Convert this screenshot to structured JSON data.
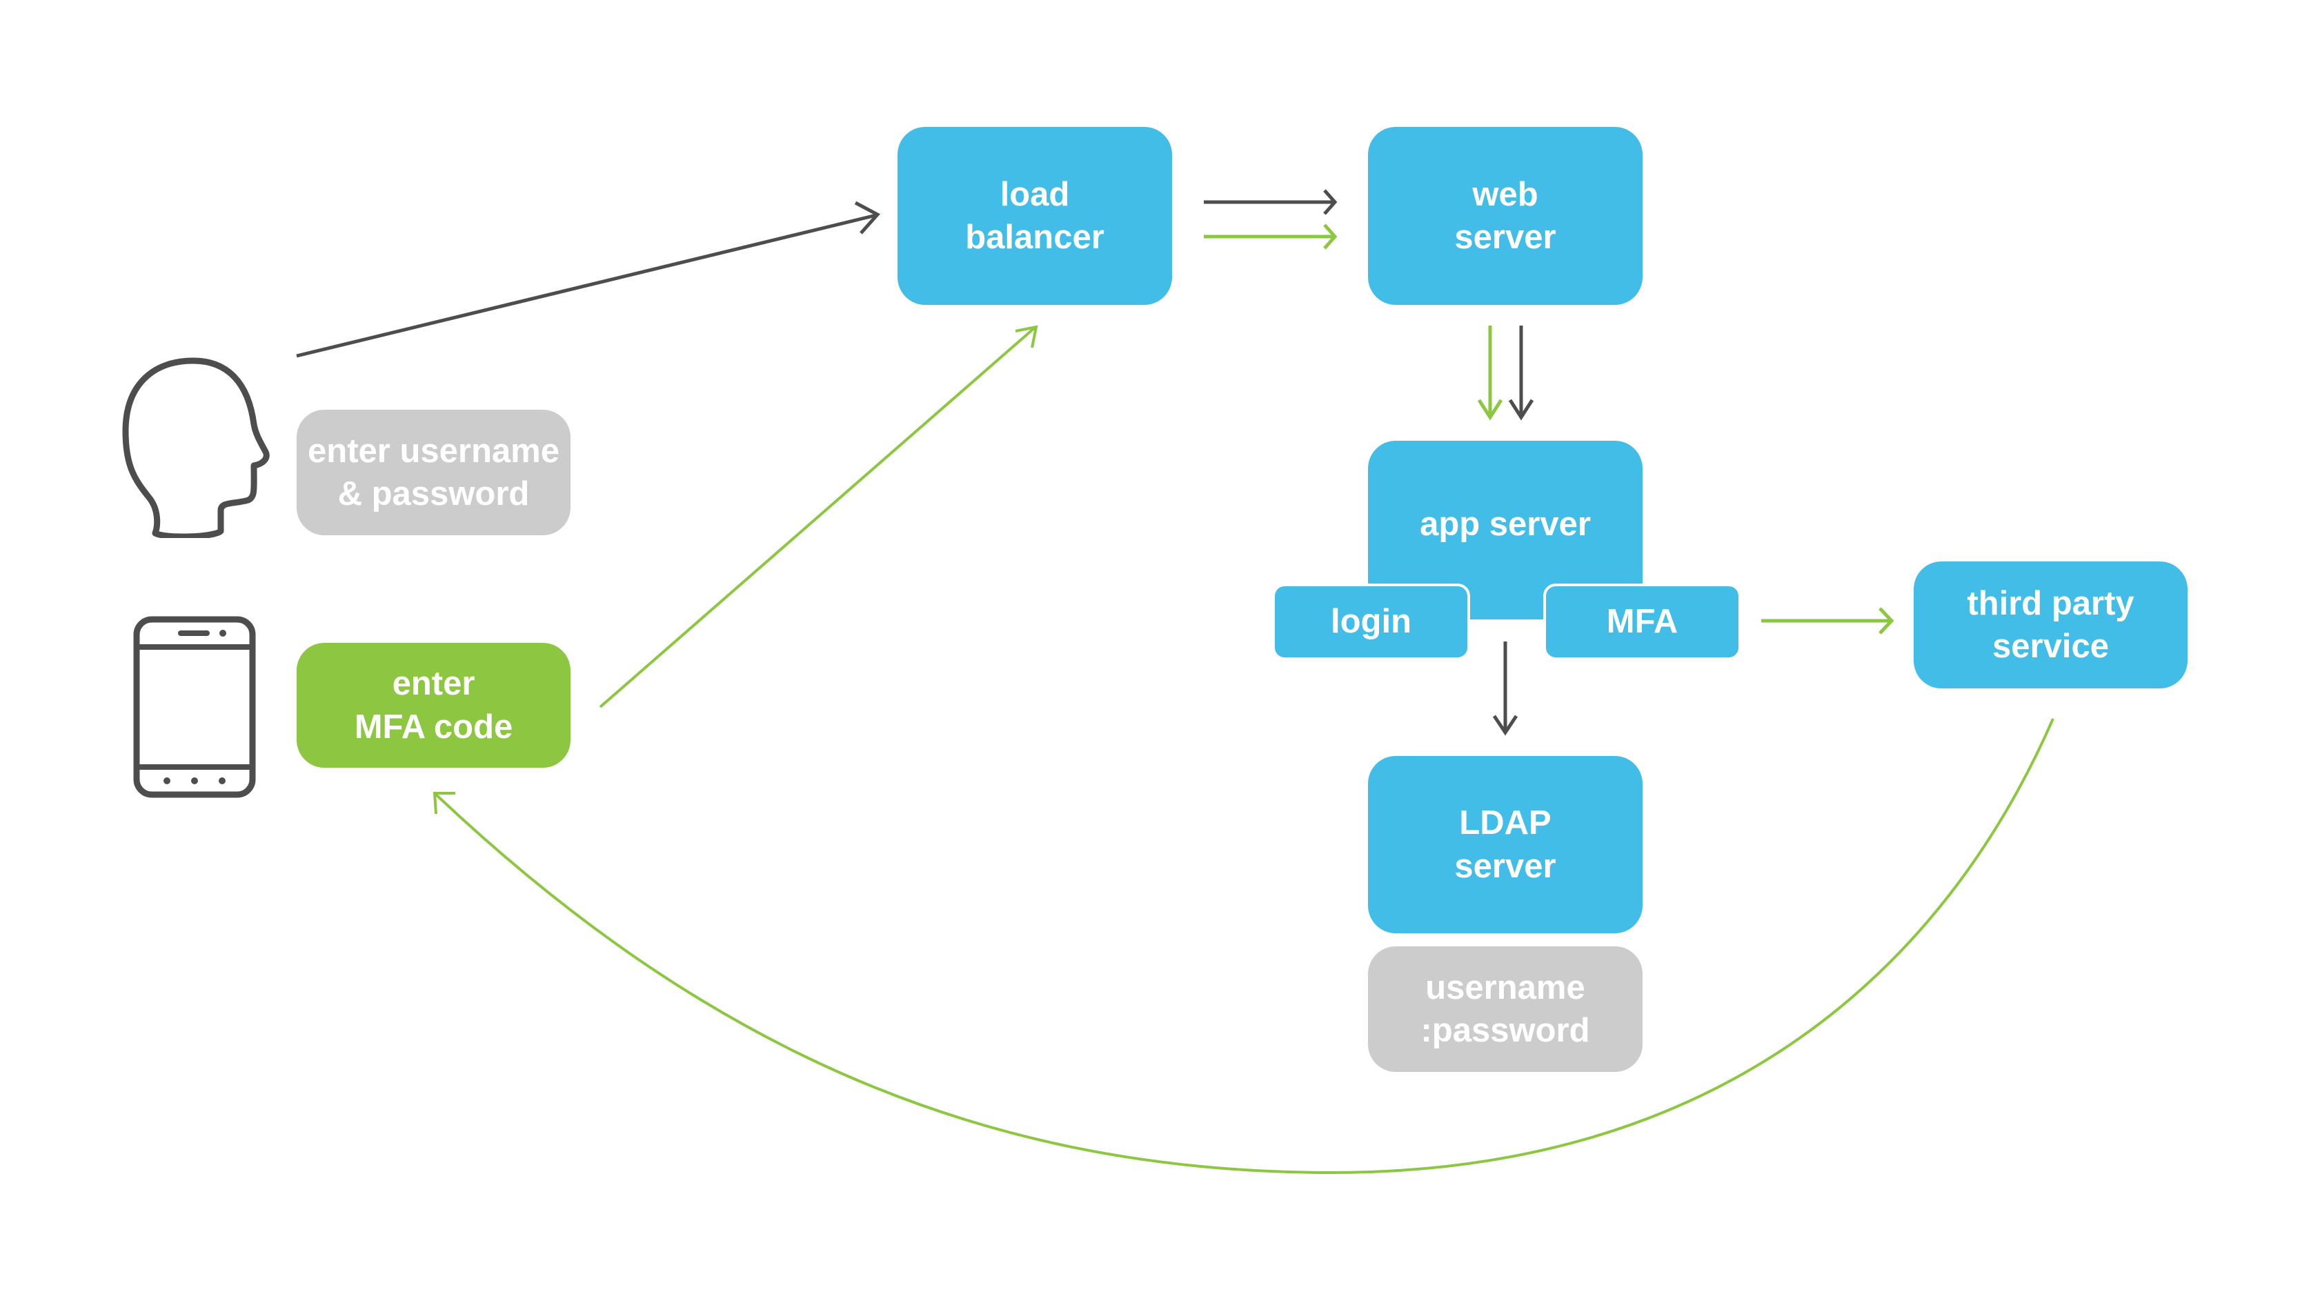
{
  "colors": {
    "node_blue": "#42bde7",
    "note_gray": "#cccccc",
    "note_green": "#8dc641",
    "arrow_dark": "#4d4d4d",
    "arrow_green": "#8dc641",
    "icon_stroke": "#4d4d4d"
  },
  "actors": {
    "user": {
      "icon": "user-head-icon",
      "note": [
        "enter username",
        "& password"
      ]
    },
    "phone": {
      "icon": "smartphone-icon",
      "note": [
        "enter",
        "MFA code"
      ]
    }
  },
  "nodes": {
    "load_balancer": [
      "load",
      "balancer"
    ],
    "web_server": [
      "web",
      "server"
    ],
    "app_server": [
      "app server"
    ],
    "login": [
      "login"
    ],
    "mfa": [
      "MFA"
    ],
    "ldap_server": [
      "LDAP",
      "server"
    ],
    "credentials_store": [
      "username",
      ":password"
    ],
    "third_party": [
      "third party",
      "service"
    ]
  },
  "edges": [
    {
      "from": "user",
      "to": "load_balancer",
      "color": "dark"
    },
    {
      "from": "load_balancer",
      "to": "web_server",
      "color": "dark"
    },
    {
      "from": "load_balancer",
      "to": "web_server",
      "color": "green"
    },
    {
      "from": "web_server",
      "to": "app_server",
      "color": "green"
    },
    {
      "from": "web_server",
      "to": "app_server",
      "color": "dark"
    },
    {
      "from": "app_server",
      "to": "ldap_server",
      "color": "dark"
    },
    {
      "from": "mfa",
      "to": "third_party",
      "color": "green"
    },
    {
      "from": "third_party",
      "to": "phone_mfa_code",
      "color": "green"
    },
    {
      "from": "phone_mfa_code",
      "to": "load_balancer",
      "color": "green"
    }
  ]
}
